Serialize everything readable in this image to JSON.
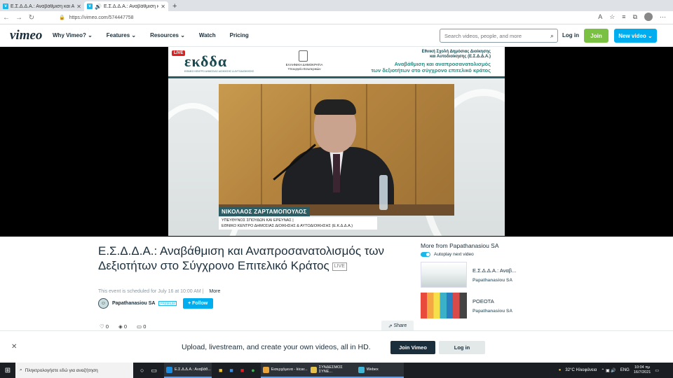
{
  "browser": {
    "tabs": [
      {
        "title": "Ε.Σ.Δ.Δ.Α.: Αναβάθμιση και Ανα"
      },
      {
        "title": "Ε.Σ.Δ.Δ.Α.: Αναβάθμιση κα"
      }
    ],
    "url": "https://vimeo.com/574447758"
  },
  "header": {
    "logo": "vimeo",
    "menu": [
      "Why Vimeo? ⌄",
      "Features ⌄",
      "Resources ⌄",
      "Watch",
      "Pricing"
    ],
    "search_placeholder": "Search videos, people, and more",
    "login": "Log in",
    "join": "Join",
    "new_video": "New video ⌄"
  },
  "player": {
    "live": "LIVE",
    "org_logo": "εκδδα",
    "org_sub": "ΕΘΝΙΚΟ ΚΕΝΤΡΟ ΔΗΜΟΣΙΑΣ ΔΙΟΙΚΗΣΗΣ & ΑΥΤΟΔΙΟΙΚΗΣΗΣ",
    "gov_line1": "ΕΛΛΗΝΙΚΗ ΔΗΜΟΚΡΑΤΙΑ",
    "gov_line2": "Υπουργείο Εσωτερικών",
    "school_line1": "Εθνική Σχολή Δημόσιας Διοίκησης",
    "school_line2": "και Αυτοδιοίκησης (Ε.Σ.Δ.Δ.Α.)",
    "event_line1": "Αναβάθμιση και αναπροσανατολισμός",
    "event_line2": "των δεξιοτήτων στο σύγχρονο επιτελικό κράτος",
    "speaker_name": "ΝΙΚΟΛΑΟΣ ΖΑΡΤΑΜΟΠΟΥΛΟΣ",
    "speaker_role1": "ΥΠΕΥΘΥΝΟΣ ΣΠΟΥΔΩΝ ΚΑΙ ΕΡΕΥΝΑΣ |",
    "speaker_role2": "ΕΘΝΙΚΟ ΚΕΝΤΡΟ ΔΗΜΟΣΙΑΣ ΔΙΟΙΚΗΣΗΣ & ΑΥΤΟΔΙΟΙΚΗΣΗΣ (Ε.Κ.Δ.Δ.Α.)"
  },
  "video": {
    "title": "Ε.Σ.Δ.Δ.Α.: Αναβάθμιση και Αναπροσανατολισμός των Δεξιοτήτων στο Σύγχρονο Επιτελικό Κράτος",
    "live_badge": "LIVE",
    "schedule": "This event is scheduled for July 16 at 10:00 AM",
    "more": "More",
    "owner": "Papathanasiou SA",
    "owner_badge": "PREMIUM",
    "follow": "+ Follow",
    "likes": "0",
    "collections": "0",
    "comments": "0",
    "share": "Share"
  },
  "sidebar": {
    "title": "More from Papathanasiou SA",
    "autoplay": "Autoplay next video",
    "items": [
      {
        "title": "Ε.Σ.Δ.Δ.Α.: Αναβ...",
        "owner": "Papathanasiou SA"
      },
      {
        "title": "POEOTA",
        "owner": "Papathanasiou SA"
      }
    ]
  },
  "banner": {
    "text": "Upload, livestream, and create your own videos, all in HD.",
    "join": "Join Vimeo",
    "login": "Log in"
  },
  "taskbar": {
    "search": "Πληκτρολογήστε εδώ για αναζήτηση",
    "apps": [
      {
        "label": "Ε.Σ.Δ.Δ.Α.: Αναβάθ...",
        "color": "#1b8de0"
      },
      {
        "label": "Εισερχόμενα - kicar...",
        "color": "#e8a33a"
      },
      {
        "label": "ΣΥΝΔΕΣΜΟΣ ΣΥΝΕ...",
        "color": "#e6c14a"
      },
      {
        "label": "Webex",
        "color": "#3fb6d5"
      }
    ],
    "weather": "32°C Ηλιοφάνεια",
    "lang": "ENG",
    "time": "10:04 πμ",
    "date": "16/7/2021"
  }
}
